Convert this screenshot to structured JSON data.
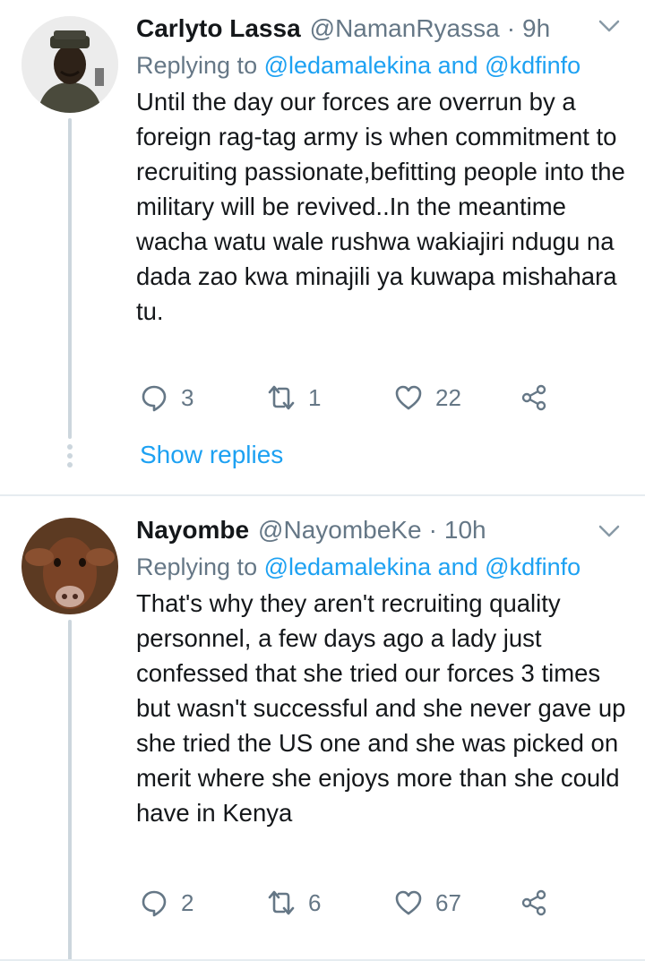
{
  "tweets": [
    {
      "name": "Carlyto Lassa",
      "handle": "@NamanRyassa",
      "separator": "·",
      "time": "9h",
      "replying_prefix": "Replying to ",
      "reply_user1": "@ledamalekina",
      "reply_and": " and ",
      "reply_user2": "@kdfinfo",
      "text": "Until the day our forces are overrun by a foreign rag-tag army is when commitment to recruiting passionate,befitting people into the military will be revived..In the meantime wacha watu wale rushwa wakiajiri ndugu na dada zao kwa minajili ya kuwapa mishahara tu.",
      "replies": "3",
      "retweets": "1",
      "likes": "22",
      "show_replies": "Show replies"
    },
    {
      "name": "Nayombe",
      "handle": "@NayombeKe",
      "separator": "·",
      "time": "10h",
      "replying_prefix": "Replying to ",
      "reply_user1": "@ledamalekina",
      "reply_and": " and ",
      "reply_user2": "@kdfinfo",
      "text": "That's why they aren't recruiting quality personnel, a few days ago a lady just confessed that she tried our forces 3 times but wasn't successful and she never gave up she tried the US one and she was picked on merit where she enjoys more than she could have in Kenya",
      "replies": "2",
      "retweets": "6",
      "likes": "67"
    }
  ],
  "icons": {
    "reply": "reply-icon",
    "retweet": "retweet-icon",
    "like": "heart-icon",
    "share": "share-icon",
    "menu": "chevron-down-icon"
  },
  "colors": {
    "link": "#1da1f2",
    "secondary": "#657786",
    "line": "#ccd6dd"
  }
}
